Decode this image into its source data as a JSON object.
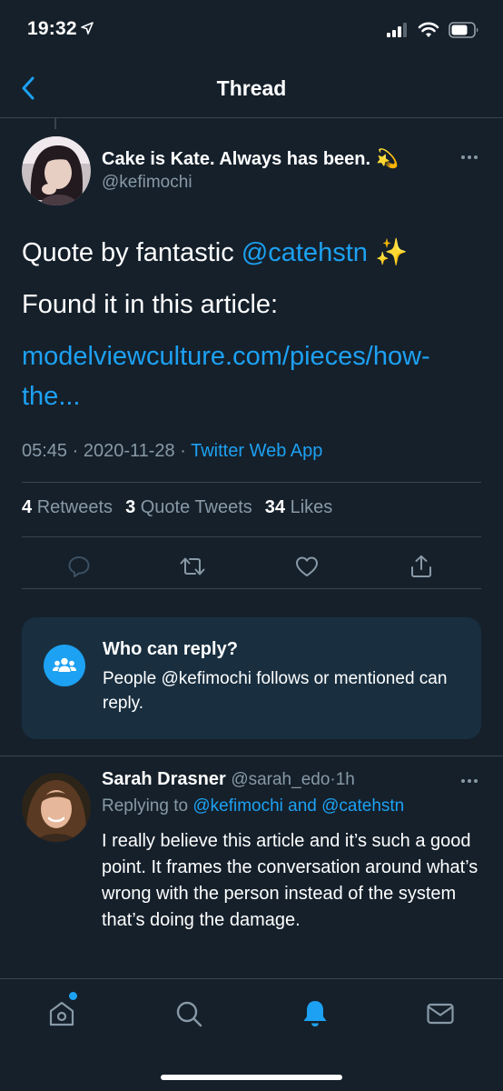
{
  "status_bar": {
    "time": "19:32"
  },
  "nav": {
    "title": "Thread"
  },
  "tweet": {
    "author_name": "Cake is Kate. Always has been.",
    "author_emoji": "💫",
    "author_handle": "@kefimochi",
    "line1_prefix": "Quote by fantastic ",
    "line1_mention": "@catehstn",
    "line1_suffix": " ✨",
    "line2": "Found it in this article:",
    "link": "modelviewculture.com/pieces/how-the...",
    "time": "05:45",
    "date": "2020-11-28",
    "separator": "·",
    "source": "Twitter Web App",
    "retweets_count": "4",
    "retweets_label": "Retweets",
    "quotes_count": "3",
    "quotes_label": "Quote Tweets",
    "likes_count": "34",
    "likes_label": "Likes"
  },
  "reply_card": {
    "title": "Who can reply?",
    "body": "People @kefimochi follows or mentioned can reply."
  },
  "reply": {
    "author_name": "Sarah Drasner",
    "author_handle": "@sarah_edo",
    "age": "1h",
    "replying_label": "Replying to ",
    "replying_to": "@kefimochi and @catehstn",
    "text": "I really believe this article and it’s such a good point. It frames the conversation around what’s wrong with the person instead of the system that’s doing the damage."
  },
  "colors": {
    "background": "#15202b",
    "accent": "#1da1f2",
    "secondary_text": "#8899a6",
    "divider": "#38444d",
    "card": "#192f40"
  }
}
